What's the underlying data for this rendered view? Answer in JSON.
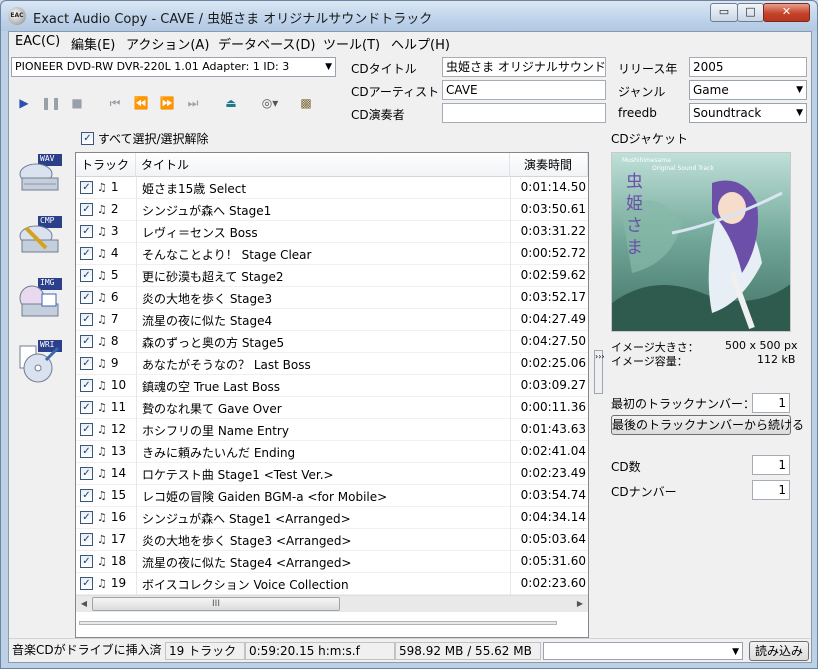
{
  "window": {
    "title": "Exact Audio Copy    -    CAVE / 虫姫さま オリジナルサウンドトラック",
    "app_icon_text": "EAC",
    "minimize": "▭",
    "maximize": "□",
    "close": "✕"
  },
  "menu": [
    "EAC(C)",
    "編集(E)",
    "アクション(A)",
    "データベース(D)",
    "ツール(T)",
    "ヘルプ(H)"
  ],
  "drive": {
    "selected": "PIONEER DVD-RW  DVR-220L 1.01  Adapter: 1  ID: 3"
  },
  "toolbar_icons": [
    "play-icon",
    "pause-icon",
    "stop-icon",
    "prev-track-icon",
    "rewind-icon",
    "forward-icon",
    "next-track-icon",
    "eject-icon",
    "cd-options-icon",
    "drive-icon"
  ],
  "metadata": {
    "cd_title_label": "CDタイトル",
    "cd_title": "虫姫さま オリジナルサウンドトラック",
    "artist_label": "CDアーティスト",
    "artist": "CAVE",
    "performer_label": "CD演奏者",
    "performer": "",
    "year_label": "リリース年",
    "year": "2005",
    "genre_label": "ジャンル",
    "genre": "Game",
    "freedb_label": "freedb",
    "freedb": "Soundtrack"
  },
  "select_all": {
    "label": "すべて選択/選択解除",
    "checked": "✓"
  },
  "side_buttons": [
    {
      "badge": "WAV",
      "icon": "copy-wav-icon"
    },
    {
      "badge": "CMP",
      "icon": "copy-compressed-icon"
    },
    {
      "badge": "IMG",
      "icon": "copy-image-icon"
    },
    {
      "badge": "WRI",
      "icon": "write-cd-icon"
    }
  ],
  "track_list": {
    "headers": [
      "トラック",
      "タイトル",
      "演奏時間"
    ],
    "rows": [
      {
        "num": "1",
        "title": "姫さま15歳 Select",
        "time": "0:01:14.50"
      },
      {
        "num": "2",
        "title": "シンジュが森へ Stage1",
        "time": "0:03:50.61"
      },
      {
        "num": "3",
        "title": "レヴィ＝センス Boss",
        "time": "0:03:31.22"
      },
      {
        "num": "4",
        "title": "そんなことより！ Stage Clear",
        "time": "0:00:52.72"
      },
      {
        "num": "5",
        "title": "更に砂漠も超えて Stage2",
        "time": "0:02:59.62"
      },
      {
        "num": "6",
        "title": "炎の大地を歩く Stage3",
        "time": "0:03:52.17"
      },
      {
        "num": "7",
        "title": "流星の夜に似た Stage4",
        "time": "0:04:27.49"
      },
      {
        "num": "8",
        "title": "森のずっと奥の方 Stage5",
        "time": "0:04:27.50"
      },
      {
        "num": "9",
        "title": "あなたがそうなの？ Last Boss",
        "time": "0:02:25.06"
      },
      {
        "num": "10",
        "title": "鎮魂の空 True Last Boss",
        "time": "0:03:09.27"
      },
      {
        "num": "11",
        "title": "贄のなれ果て Gave Over",
        "time": "0:00:11.36"
      },
      {
        "num": "12",
        "title": "ホシフリの里 Name Entry",
        "time": "0:01:43.63"
      },
      {
        "num": "13",
        "title": "きみに頼みたいんだ Ending",
        "time": "0:02:41.04"
      },
      {
        "num": "14",
        "title": "ロケテスト曲 Stage1 <Test Ver.>",
        "time": "0:02:23.49"
      },
      {
        "num": "15",
        "title": "レコ姫の冒険 Gaiden BGM-a <for Mobile>",
        "time": "0:03:54.74"
      },
      {
        "num": "16",
        "title": "シンジュが森へ Stage1 <Arranged>",
        "time": "0:04:34.14"
      },
      {
        "num": "17",
        "title": "炎の大地を歩く Stage3 <Arranged>",
        "time": "0:05:03.64"
      },
      {
        "num": "18",
        "title": "流星の夜に似た Stage4 <Arranged>",
        "time": "0:05:31.60"
      },
      {
        "num": "19",
        "title": "ボイスコレクション Voice Collection",
        "time": "0:02:23.60"
      }
    ],
    "scroll_left": "◀",
    "scroll_right": "▶",
    "scroll_grip": "III"
  },
  "splitter_arrows": "›››",
  "cover": {
    "label": "CDジャケット",
    "art_title": "虫姫さま",
    "art_subtitle_1": "Mushihimesama",
    "art_subtitle_2": "Original Sound Track",
    "image_size_label": "イメージ大きさ：",
    "image_size": "500 x 500 px",
    "image_bytes_label": "イメージ容量：",
    "image_bytes": "112 kB"
  },
  "numbering": {
    "first_track_label": "最初のトラックナンバー：",
    "first_track": "1",
    "continue_button": "最後のトラックナンバーから続ける",
    "cd_count_label": "CD数",
    "cd_count": "1",
    "cd_number_label": "CDナンバー",
    "cd_number": "1"
  },
  "status": {
    "message": "音楽CDがドライブに挿入済",
    "tracks": "19 トラック",
    "length": "0:59:20.15 h:m:s.f",
    "size": "598.92 MB / 55.62 MB",
    "dropdown": "",
    "load_button": "読み込み"
  },
  "colors": {
    "accent_blue": "#2a5fb8",
    "title_bar": "#bfd3ea",
    "close_red": "#c5432a"
  }
}
